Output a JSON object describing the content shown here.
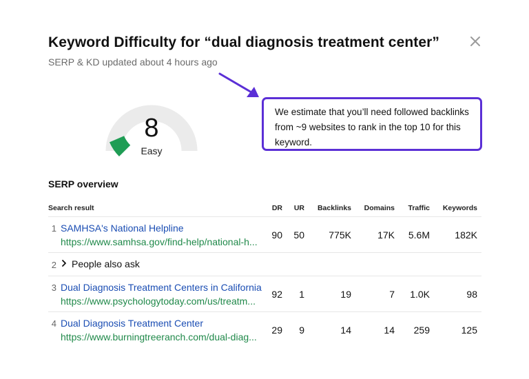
{
  "header": {
    "title": "Keyword Difficulty for “dual diagnosis treatment center”",
    "subtitle": "SERP & KD updated about 4 hours ago"
  },
  "kd": {
    "score": "8",
    "label": "Easy",
    "fraction": 0.08,
    "track_color": "#ebebeb",
    "fill_color": "#1f9d55"
  },
  "callout": {
    "text": "We estimate that you’ll need followed backlinks from ~9 websites to rank in the top 10 for this keyword.",
    "border_color": "#5b2fd6"
  },
  "serp": {
    "section_title": "SERP overview",
    "columns": {
      "result": "Search result",
      "dr": "DR",
      "ur": "UR",
      "backlinks": "Backlinks",
      "domains": "Domains",
      "traffic": "Traffic",
      "keywords": "Keywords"
    },
    "rows": [
      {
        "num": "1",
        "title": "SAMHSA's National Helpline",
        "url": "https://www.samhsa.gov/find-help/national-h...",
        "dr": "90",
        "ur": "50",
        "backlinks": "775K",
        "domains": "17K",
        "traffic": "5.6M",
        "keywords": "182K"
      },
      {
        "num": "2",
        "label": "People also ask"
      },
      {
        "num": "3",
        "title": "Dual Diagnosis Treatment Centers in California",
        "url": "https://www.psychologytoday.com/us/treatm...",
        "dr": "92",
        "ur": "1",
        "backlinks": "19",
        "domains": "7",
        "traffic": "1.0K",
        "keywords": "98"
      },
      {
        "num": "4",
        "title": "Dual Diagnosis Treatment Center",
        "url": "https://www.burningtreeranch.com/dual-diag...",
        "dr": "29",
        "ur": "9",
        "backlinks": "14",
        "domains": "14",
        "traffic": "259",
        "keywords": "125"
      }
    ]
  }
}
